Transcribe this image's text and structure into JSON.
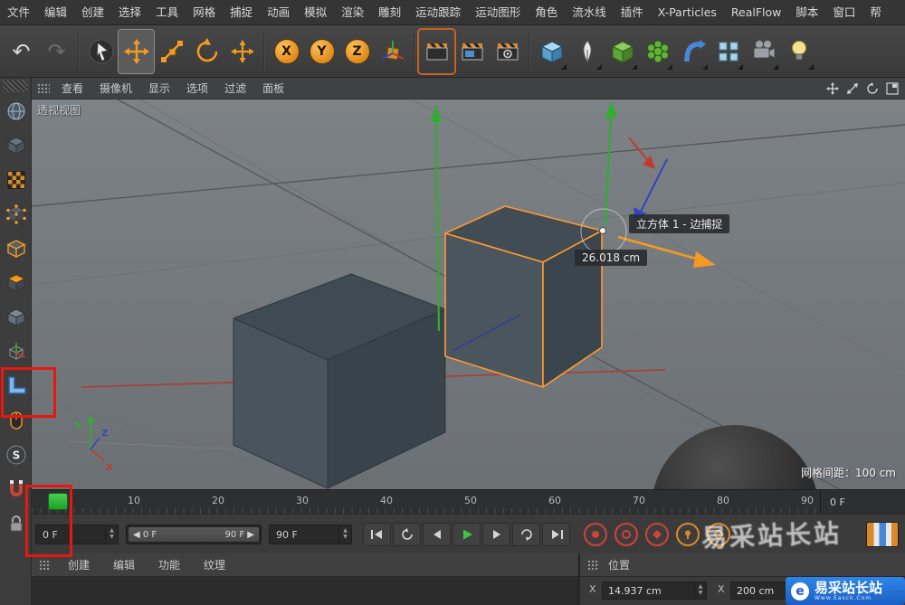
{
  "menu_bar": {
    "items": [
      "文件",
      "编辑",
      "创建",
      "选择",
      "工具",
      "网格",
      "捕捉",
      "动画",
      "模拟",
      "渲染",
      "雕刻",
      "运动跟踪",
      "运动图形",
      "角色",
      "流水线",
      "插件",
      "X-Particles",
      "RealFlow",
      "脚本",
      "窗口",
      "帮"
    ]
  },
  "toolbar": {
    "axis_x": "X",
    "axis_y": "Y",
    "axis_z": "Z",
    "icons": [
      "undo",
      "redo",
      "live-selection",
      "move",
      "scale",
      "rotate",
      "last-tool-move",
      "lock-x",
      "lock-y",
      "lock-z",
      "coordinate-system",
      "render-view",
      "render-picture-viewer",
      "render-settings",
      "add-cube-primitive",
      "pen-spline",
      "subdivision-surface",
      "generators",
      "deformers",
      "mograph-array",
      "camera",
      "light"
    ]
  },
  "sidebar": {
    "snap_letter": "S",
    "icons": [
      "globe",
      "model-cube",
      "texture-checker",
      "points-mode",
      "edges-mode",
      "polygons-mode",
      "object-mode",
      "axis-mode",
      "workplane",
      "mouse-input",
      "snap-s",
      "magnet-snap",
      "lock"
    ]
  },
  "viewport": {
    "menu_items": [
      "查看",
      "摄像机",
      "显示",
      "选项",
      "过滤",
      "面板"
    ],
    "view_label": "透视视图",
    "snap_tooltip": "立方体 1 - 边捕捉",
    "snap_distance": "26.018 cm",
    "grid_spacing_label": "网格间距：100 cm",
    "axis_x": "X",
    "axis_y": "Y",
    "axis_z": "Z"
  },
  "timeline": {
    "ticks": [
      "10",
      "20",
      "30",
      "40",
      "50",
      "60",
      "70",
      "80",
      "90"
    ],
    "frame_display": "0 F"
  },
  "transport": {
    "current_frame": "0 F",
    "range_start": "0 F",
    "range_end": "90 F",
    "end_frame": "90 F"
  },
  "materials_panel": {
    "menu_items": [
      "创建",
      "编辑",
      "功能",
      "纹理"
    ]
  },
  "coordinates_panel": {
    "title": "位置",
    "fields": [
      {
        "label": "X",
        "value": "14.937 cm"
      },
      {
        "label": "X",
        "value": "200 cm"
      }
    ]
  },
  "watermark_overlay": {
    "text": "易采站长站"
  },
  "brand": {
    "logo_letter": "e",
    "name": "易采站长站",
    "sub": "Www.Easck.Com"
  },
  "colors": {
    "accent_orange": "#f59a21",
    "selection_orange": "#ff9a2e",
    "axis_green": "#2fae2f",
    "axis_red": "#c4392c",
    "axis_blue": "#3646c0",
    "annotation_red": "#e8170f",
    "play_green": "#3ec73e",
    "brand_blue": "#1b5fc4",
    "viewport_gray": "#747a7e"
  }
}
